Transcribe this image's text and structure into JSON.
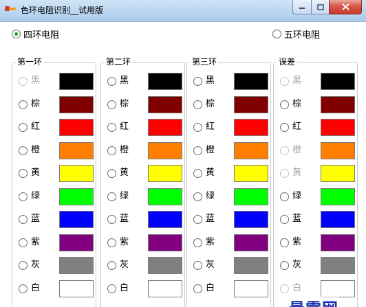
{
  "window": {
    "title": "色环电阻识别__试用版",
    "icons": {
      "app": "resistor-app-icon",
      "minimize": "minimize-icon",
      "maximize": "maximize-icon",
      "close": "close-icon"
    }
  },
  "mode": {
    "four_band": {
      "label": "四环电阻",
      "checked": true
    },
    "five_band": {
      "label": "五环电阻",
      "checked": false
    }
  },
  "groups": [
    {
      "title": "第一环",
      "rows": [
        {
          "label": "黑",
          "color": "#000000",
          "disabled": true
        },
        {
          "label": "棕",
          "color": "#800000",
          "disabled": false
        },
        {
          "label": "红",
          "color": "#ff0000",
          "disabled": false
        },
        {
          "label": "橙",
          "color": "#ff8000",
          "disabled": false
        },
        {
          "label": "黄",
          "color": "#ffff00",
          "disabled": false
        },
        {
          "label": "绿",
          "color": "#00ff00",
          "disabled": false
        },
        {
          "label": "蓝",
          "color": "#0000ff",
          "disabled": false
        },
        {
          "label": "紫",
          "color": "#800080",
          "disabled": false
        },
        {
          "label": "灰",
          "color": "#808080",
          "disabled": false
        },
        {
          "label": "白",
          "color": "#ffffff",
          "disabled": false
        }
      ]
    },
    {
      "title": "第二环",
      "rows": [
        {
          "label": "黑",
          "color": "#000000",
          "disabled": false
        },
        {
          "label": "棕",
          "color": "#800000",
          "disabled": false
        },
        {
          "label": "红",
          "color": "#ff0000",
          "disabled": false
        },
        {
          "label": "橙",
          "color": "#ff8000",
          "disabled": false
        },
        {
          "label": "黄",
          "color": "#ffff00",
          "disabled": false
        },
        {
          "label": "绿",
          "color": "#00ff00",
          "disabled": false
        },
        {
          "label": "蓝",
          "color": "#0000ff",
          "disabled": false
        },
        {
          "label": "紫",
          "color": "#800080",
          "disabled": false
        },
        {
          "label": "灰",
          "color": "#808080",
          "disabled": false
        },
        {
          "label": "白",
          "color": "#ffffff",
          "disabled": false
        }
      ]
    },
    {
      "title": "第三环",
      "rows": [
        {
          "label": "黑",
          "color": "#000000",
          "disabled": false
        },
        {
          "label": "棕",
          "color": "#800000",
          "disabled": false
        },
        {
          "label": "红",
          "color": "#ff0000",
          "disabled": false
        },
        {
          "label": "橙",
          "color": "#ff8000",
          "disabled": false
        },
        {
          "label": "黄",
          "color": "#ffff00",
          "disabled": false
        },
        {
          "label": "绿",
          "color": "#00ff00",
          "disabled": false
        },
        {
          "label": "蓝",
          "color": "#0000ff",
          "disabled": false
        },
        {
          "label": "紫",
          "color": "#800080",
          "disabled": false
        },
        {
          "label": "灰",
          "color": "#808080",
          "disabled": false
        },
        {
          "label": "白",
          "color": "#ffffff",
          "disabled": false
        }
      ]
    },
    {
      "title": "误差",
      "rows": [
        {
          "label": "黑",
          "color": "#000000",
          "disabled": true
        },
        {
          "label": "棕",
          "color": "#800000",
          "disabled": false
        },
        {
          "label": "红",
          "color": "#ff0000",
          "disabled": false
        },
        {
          "label": "橙",
          "color": "#ff8000",
          "disabled": true
        },
        {
          "label": "黄",
          "color": "#ffff00",
          "disabled": true
        },
        {
          "label": "绿",
          "color": "#00ff00",
          "disabled": false
        },
        {
          "label": "蓝",
          "color": "#0000ff",
          "disabled": false
        },
        {
          "label": "紫",
          "color": "#800080",
          "disabled": false
        },
        {
          "label": "灰",
          "color": "#808080",
          "disabled": false
        },
        {
          "label": "白",
          "color": "#ffffff",
          "disabled": true
        }
      ]
    }
  ],
  "watermark": "最需网"
}
